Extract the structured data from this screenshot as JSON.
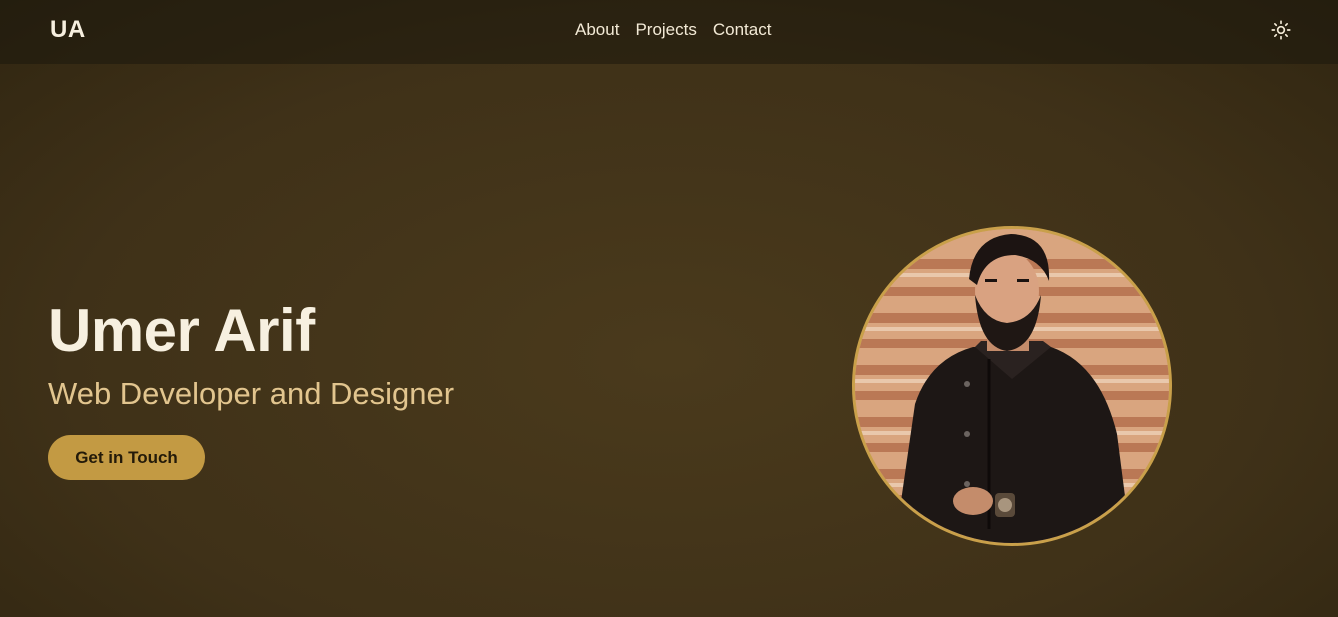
{
  "header": {
    "logo": "UA",
    "nav": {
      "about": "About",
      "projects": "Projects",
      "contact": "Contact"
    },
    "theme_icon": "sun-icon"
  },
  "hero": {
    "name": "Umer Arif",
    "subtitle": "Web Developer and Designer",
    "cta_label": "Get in Touch",
    "avatar_alt": "profile-photo"
  },
  "colors": {
    "background": "#3f3118",
    "accent": "#c39a43",
    "subtitle": "#e2c58e",
    "text": "#f3ead6"
  }
}
